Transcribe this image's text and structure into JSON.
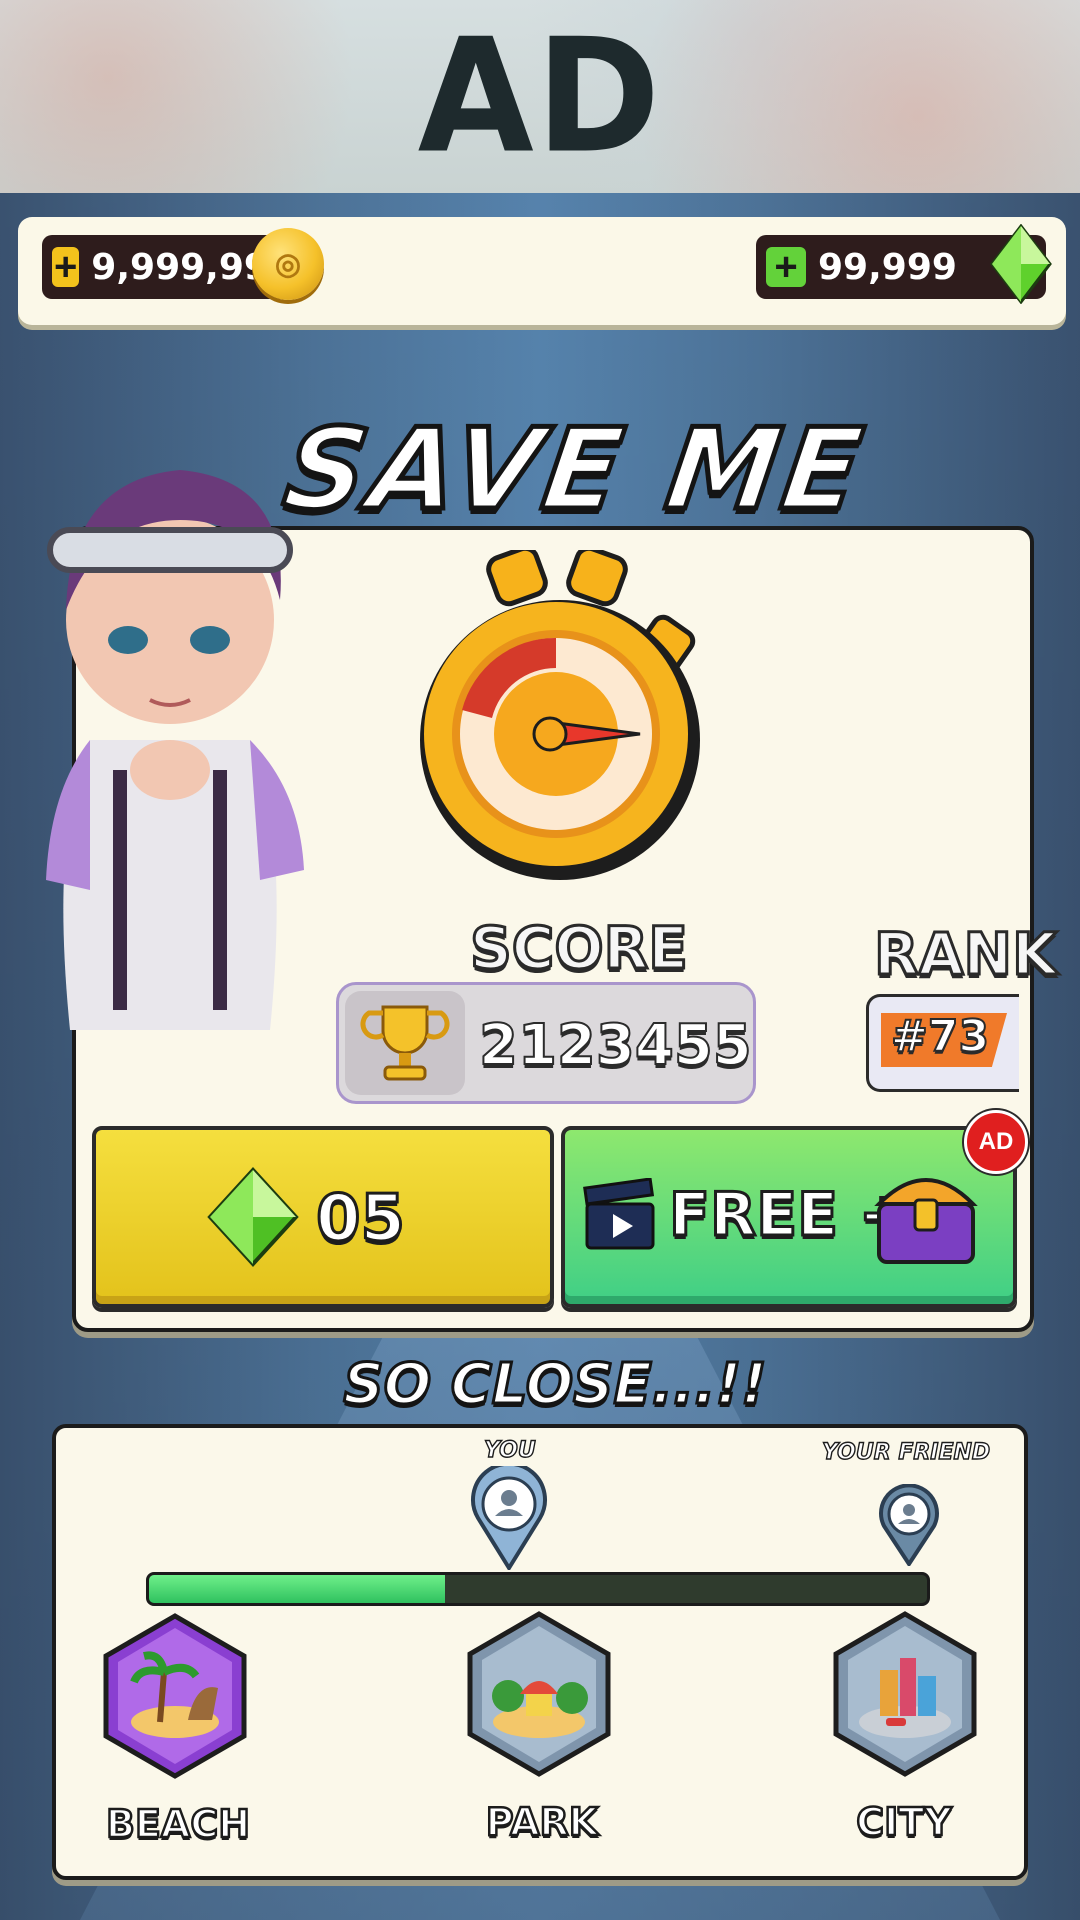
{
  "ad_banner": {
    "label": "AD"
  },
  "currency": {
    "coins": "9,999,999",
    "gems": "99,999",
    "coin_icon": "coin-icon",
    "gem_icon": "green-gem-icon"
  },
  "save_me": {
    "title": "SAVE ME",
    "score_label": "SCORE",
    "score_value": "2123455",
    "rank_label": "RANK",
    "rank_value": "#73",
    "gem_button_value": "05",
    "free_button_text": "FREE +",
    "ad_badge": "AD"
  },
  "progress": {
    "heading": "SO CLOSE...!!",
    "you_label": "YOU",
    "friend_label": "YOUR FRIEND",
    "fill_fraction": 0.38,
    "locations": [
      "BEACH",
      "PARK",
      "CITY"
    ]
  },
  "colors": {
    "accent_yellow": "#e3c21b",
    "accent_green": "#3fcf86",
    "rank_orange": "#f07a2a",
    "ad_red": "#e01f1f"
  }
}
